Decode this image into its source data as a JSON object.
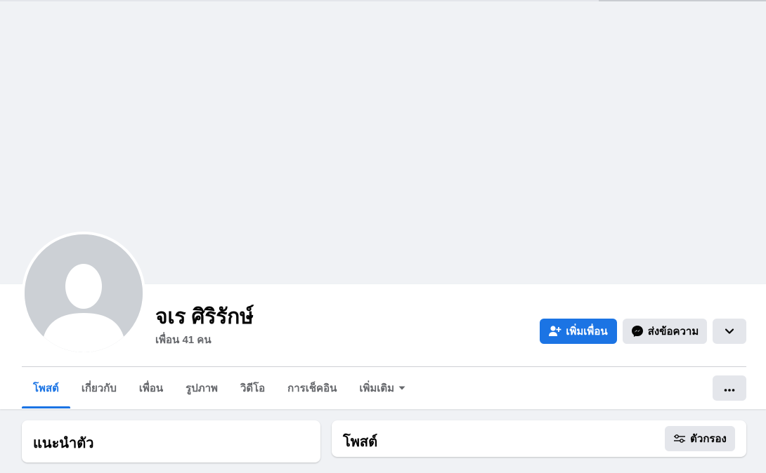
{
  "profile": {
    "name": "จเร ศิริรักษ์",
    "friends_count": "เพื่อน 41 คน"
  },
  "actions": {
    "add_friend_label": "เพิ่มเพื่อน",
    "message_label": "ส่งข้อความ"
  },
  "tabs": [
    {
      "label": "โพสต์",
      "active": true
    },
    {
      "label": "เกี่ยวกับ",
      "active": false
    },
    {
      "label": "เพื่อน",
      "active": false
    },
    {
      "label": "รูปภาพ",
      "active": false
    },
    {
      "label": "วิดีโอ",
      "active": false
    },
    {
      "label": "การเช็คอิน",
      "active": false
    },
    {
      "label": "เพิ่มเติม",
      "active": false
    }
  ],
  "intro_card": {
    "title": "แนะนำตัว"
  },
  "posts_card": {
    "title": "โพสต์",
    "filter_label": "ตัวกรอง"
  },
  "colors": {
    "accent": "#1b74e4",
    "background": "#f0f2f5",
    "secondary_button": "#e4e6eb",
    "muted_text": "#65676b"
  },
  "icons": {
    "add_friend": "person-plus-icon",
    "message": "messenger-icon",
    "profile_more": "chevron-down-icon",
    "tab_more": "ellipsis-icon",
    "more_tab_caret": "caret-down-icon",
    "filter": "filter-sliders-icon"
  }
}
